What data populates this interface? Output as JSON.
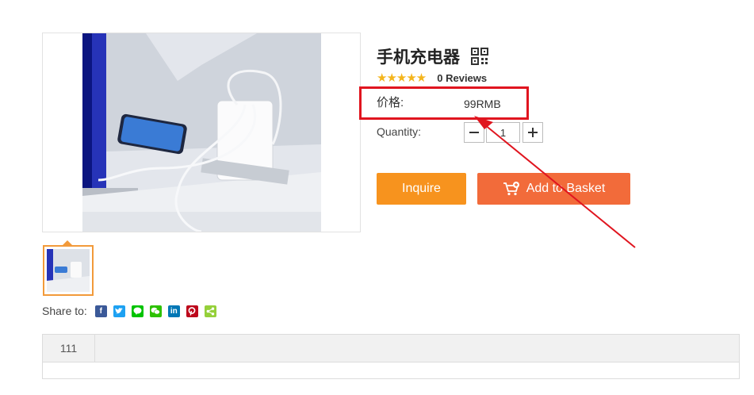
{
  "product": {
    "title": "手机充电器",
    "reviews": "0 Reviews",
    "rating_stars": 5,
    "price_label": "价格:",
    "price_value": "99RMB",
    "quantity_label": "Quantity:",
    "quantity_value": "1"
  },
  "actions": {
    "inquire_label": "Inquire",
    "basket_label": "Add to Basket"
  },
  "share": {
    "label": "Share to:",
    "icons": [
      "facebook-icon",
      "twitter-icon",
      "line-icon",
      "wechat-icon",
      "linkedin-icon",
      "pinterest-icon",
      "sharethis-icon"
    ]
  },
  "tabs": [
    {
      "label": "111"
    }
  ],
  "colors": {
    "inquire": "#f7931e",
    "basket": "#f26b3a",
    "stars": "#f4b51d",
    "annotation": "#e0151f",
    "thumb_border": "#f29a3a"
  }
}
